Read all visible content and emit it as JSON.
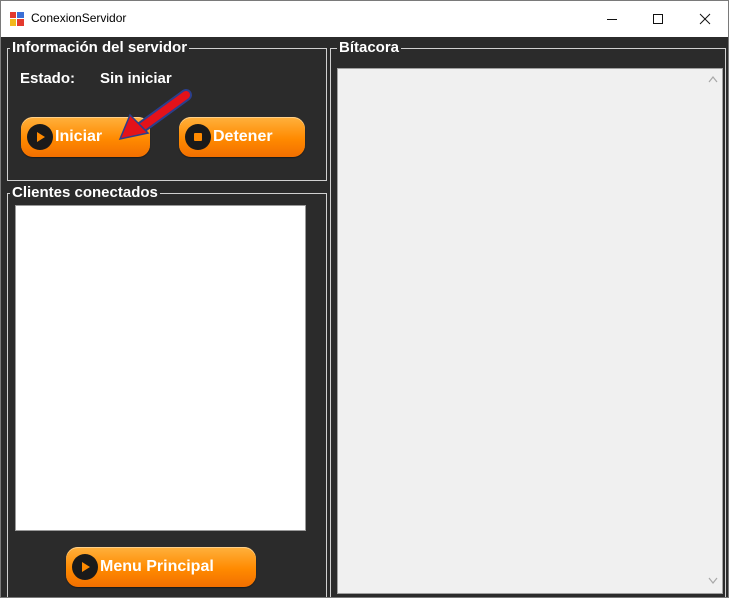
{
  "window": {
    "title": "ConexionServidor",
    "controls": {
      "minimize": "—",
      "maximize": "☐",
      "close": "✕"
    }
  },
  "server_info": {
    "legend": "Información del servidor",
    "status_label": "Estado:",
    "status_value": "Sin iniciar",
    "start_button": "Iniciar",
    "stop_button": "Detener"
  },
  "clients": {
    "legend": "Clientes conectados",
    "items": []
  },
  "main_menu_button": "Menu Principal",
  "log": {
    "legend": "Bítacora",
    "content": ""
  },
  "colors": {
    "background": "#2b2b2b",
    "button_orange": "#ff8a00",
    "annotation_arrow": "#e3121a"
  }
}
